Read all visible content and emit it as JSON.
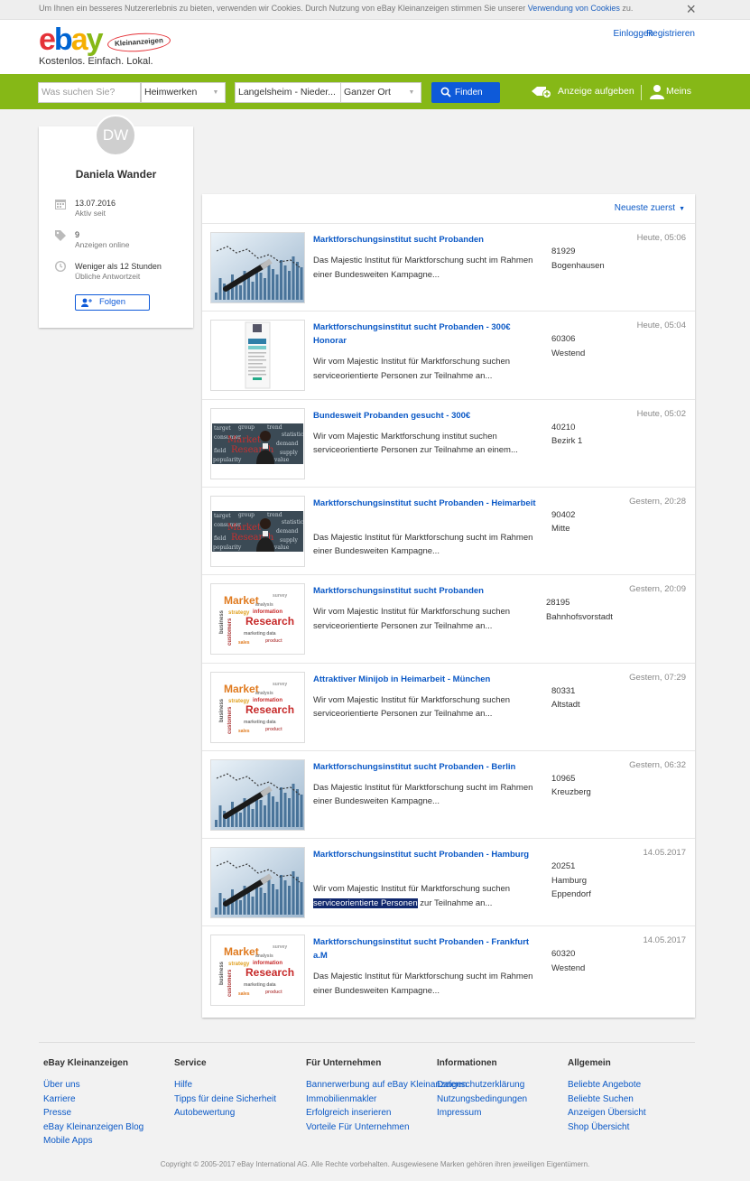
{
  "cookie": {
    "text": "Um Ihnen ein besseres Nutzererlebnis zu bieten, verwenden wir Cookies. Durch Nutzung von eBay Kleinanzeigen stimmen Sie unserer",
    "link": "Verwendung von Cookies",
    "suffix": "zu.",
    "close": "×"
  },
  "header": {
    "logo_e": "e",
    "logo_b": "b",
    "logo_a": "a",
    "logo_y": "y",
    "logo_sub": "Kleinanzeigen",
    "tagline": "Kostenlos. Einfach. Lokal.",
    "login": "Einloggen",
    "register": "Registrieren"
  },
  "search": {
    "query_placeholder": "Was suchen Sie?",
    "category": "Heimwerken",
    "location": "Langelsheim - Nieder...",
    "radius": "Ganzer Ort",
    "find": "Finden",
    "post_ad": "Anzeige aufgeben",
    "meins": "Meins"
  },
  "profile": {
    "initials": "DW",
    "name": "Daniela Wander",
    "since_value": "13.07.2016",
    "since_label": "Aktiv seit",
    "ads_value": "9",
    "ads_label": "Anzeigen online",
    "response_value": "Weniger als 12 Stunden",
    "response_label": "Übliche Antwortzeit",
    "follow": "Folgen"
  },
  "results": {
    "sort": "Neueste zuerst",
    "items": [
      {
        "title": "Marktforschungsinstitut sucht Probanden",
        "desc": "Das Majestic Institut für Marktforschung sucht im Rahmen einer Bundesweiten Kampagne...",
        "zip": "81929",
        "district": "Bogenhausen",
        "date": "Heute, 05:06",
        "img": "pen"
      },
      {
        "title": "Marktforschungsinstitut sucht Probanden - 300€ Honorar",
        "desc": "Wir vom Majestic Institut für Marktforschung suchen serviceorientierte Personen zur Teilnahme an...",
        "zip": "60306",
        "district": "Westend",
        "date": "Heute, 05:04",
        "img": "doc"
      },
      {
        "title": "Bundesweit Probanden gesucht - 300€",
        "desc": "Wir vom Majestic Marktforschung institut suchen serviceorientierte Personen zur Teilnahme an einem...",
        "zip": "40210",
        "district": "Bezirk 1",
        "date": "Heute, 05:02",
        "img": "board"
      },
      {
        "title": "Marktforschungsinstitut sucht Probanden - Heimarbeit",
        "desc": "Das Majestic Institut für Marktforschung sucht im Rahmen einer Bundesweiten Kampagne...",
        "zip": "90402",
        "district": "Mitte",
        "date": "Gestern, 20:28",
        "img": "board"
      },
      {
        "title": "Marktforschungsinstitut sucht Probanden",
        "desc": "Wir vom Majestic Institut für Marktforschung suchen serviceorientierte Personen zur Teilnahme an...",
        "zip": "28195",
        "district": "Bahnhofsvorstadt",
        "date": "Gestern, 20:09",
        "img": "cloud"
      },
      {
        "title": "Attraktiver Minijob in Heimarbeit - München",
        "desc": "Wir vom Majestic Institut für Marktforschung suchen serviceorientierte Personen zur Teilnahme an...",
        "zip": "80331",
        "district": "Altstadt",
        "date": "Gestern, 07:29",
        "img": "cloud"
      },
      {
        "title": "Marktforschungsinstitut sucht Probanden - Berlin",
        "desc": "Das Majestic Institut für Marktforschung sucht im Rahmen einer Bundesweiten Kampagne...",
        "zip": "10965",
        "district": "Kreuzberg",
        "date": "Gestern, 06:32",
        "img": "pen"
      },
      {
        "title": "Marktforschungsinstitut sucht Probanden - Hamburg",
        "desc_pre": "Wir vom Majestic Institut für Marktforschung suchen",
        "desc_hl": "serviceorientierte Personen",
        "desc_post": "zur Teilnahme an...",
        "zip": "20251",
        "district": "Hamburg",
        "district2": "Eppendorf",
        "date": "14.05.2017",
        "img": "pen"
      },
      {
        "title": "Marktforschungsinstitut sucht Probanden - Frankfurt a.M",
        "desc": "Das Majestic Institut für Marktforschung sucht im Rahmen einer Bundesweiten Kampagne...",
        "zip": "60320",
        "district": "Westend",
        "date": "14.05.2017",
        "img": "cloud"
      }
    ]
  },
  "footer": {
    "columns": [
      {
        "head": "eBay Kleinanzeigen",
        "links": [
          "Über uns",
          "Karriere",
          "Presse",
          "eBay Kleinanzeigen Blog",
          "Mobile Apps"
        ]
      },
      {
        "head": "Service",
        "links": [
          "Hilfe",
          "Tipps für deine Sicherheit",
          "Autobewertung"
        ]
      },
      {
        "head": "Für Unternehmen",
        "links": [
          "Bannerwerbung auf eBay Kleinanzeigen",
          "Immobilienmakler",
          "Erfolgreich inserieren",
          "Vorteile Für Unternehmen"
        ]
      },
      {
        "head": "Informationen",
        "links": [
          "Datenschutzerklärung",
          "Nutzungsbedingungen",
          "Impressum"
        ]
      },
      {
        "head": "Allgemein",
        "links": [
          "Beliebte Angebote",
          "Beliebte Suchen",
          "Anzeigen Übersicht",
          "Shop Übersicht"
        ]
      }
    ],
    "copyright": "Copyright © 2005-2017 eBay International AG. Alle Rechte vorbehalten. Ausgewiesene Marken gehören ihren jeweiligen Eigentümern."
  },
  "colors": {
    "brand_green": "#86b817",
    "link_blue": "#0a58c6",
    "button_blue": "#0e5ad9"
  },
  "icons": [
    "close-icon",
    "search-icon",
    "post-ad-icon",
    "user-icon",
    "calendar-icon",
    "tag-icon",
    "clock-icon",
    "follow-user-icon",
    "chevron-down-icon"
  ]
}
